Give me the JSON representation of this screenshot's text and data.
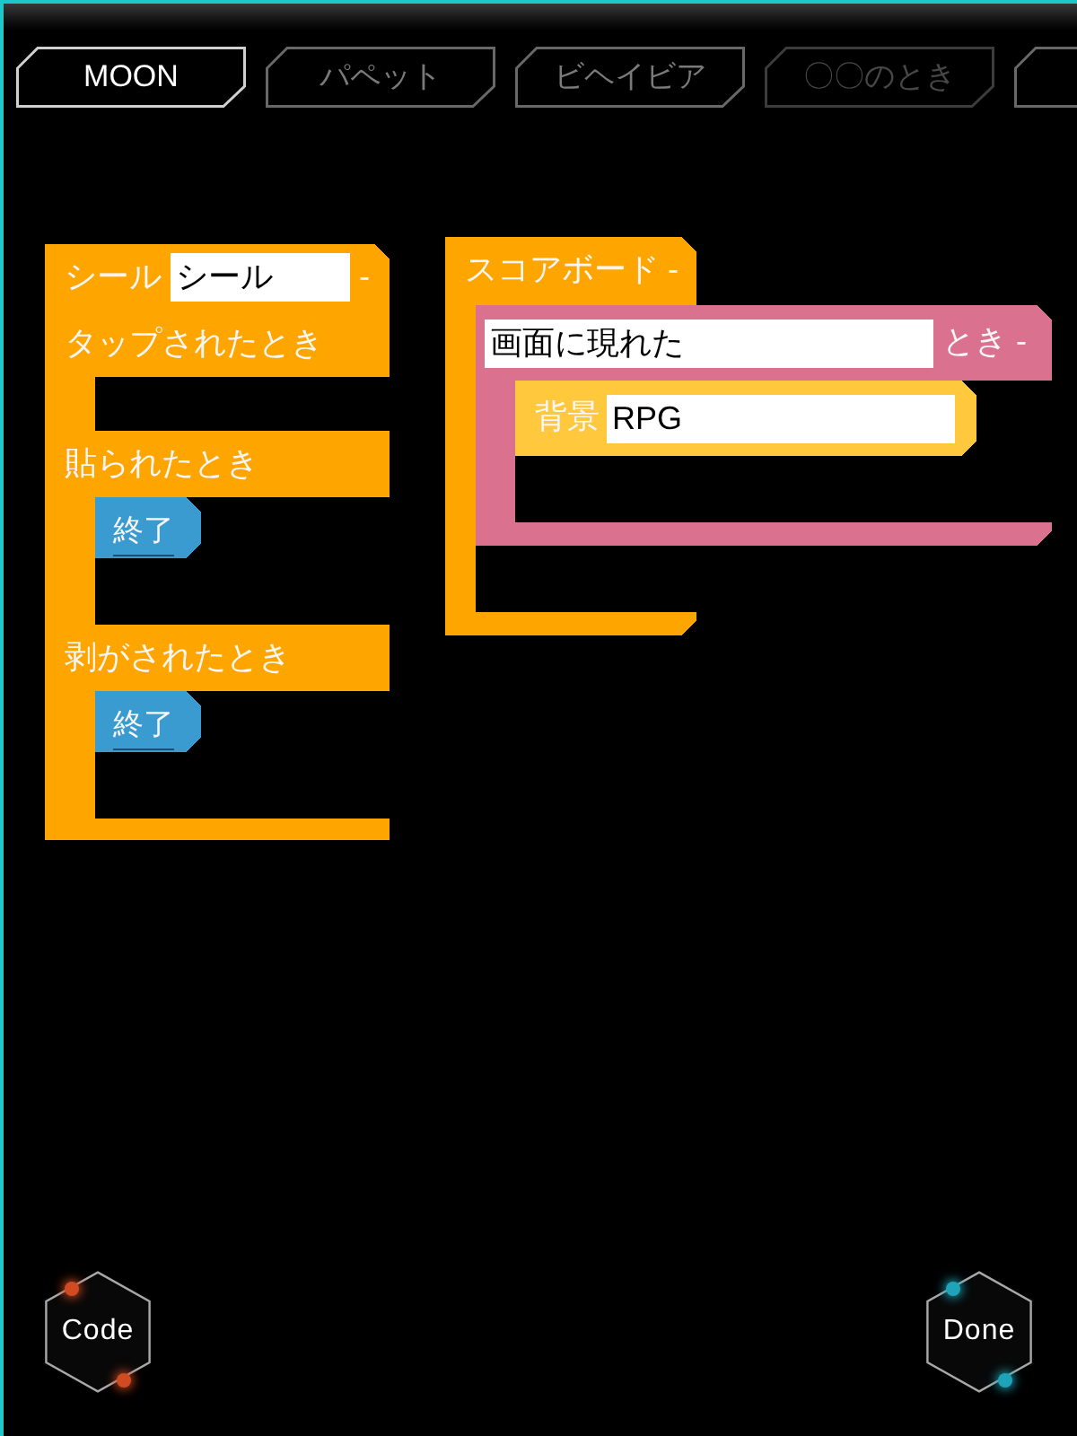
{
  "tabs": [
    {
      "label": "MOON",
      "selected": true,
      "disabled": false
    },
    {
      "label": "パペット",
      "selected": false,
      "disabled": false
    },
    {
      "label": "ビヘイビア",
      "selected": false,
      "disabled": false
    },
    {
      "label": "〇〇のとき",
      "selected": false,
      "disabled": true
    }
  ],
  "canvas": {
    "blocks": [
      {
        "kind": "event",
        "color": "#ffa500",
        "rows": [
          {
            "kind": "line",
            "parts": [
              {
                "kind": "label",
                "text": "シール"
              },
              {
                "kind": "field",
                "value": "シール"
              },
              {
                "kind": "menu",
                "text": "-"
              }
            ]
          },
          {
            "kind": "line",
            "parts": [
              {
                "kind": "label",
                "text": "タップされたとき"
              }
            ]
          },
          {
            "kind": "slot"
          },
          {
            "kind": "line",
            "parts": [
              {
                "kind": "label",
                "text": "貼られたとき"
              }
            ]
          },
          {
            "kind": "slot",
            "blocks": [
              {
                "kind": "action",
                "color": "#3a9bd0",
                "rows": [
                  {
                    "kind": "line",
                    "parts": [
                      {
                        "kind": "label",
                        "text": "終了"
                      }
                    ]
                  }
                ]
              }
            ]
          },
          {
            "kind": "line",
            "parts": [
              {
                "kind": "label",
                "text": "剥がされたとき"
              }
            ]
          },
          {
            "kind": "slot",
            "blocks": [
              {
                "kind": "action",
                "color": "#3a9bd0",
                "rows": [
                  {
                    "kind": "line",
                    "parts": [
                      {
                        "kind": "label",
                        "text": "終了"
                      }
                    ]
                  }
                ]
              }
            ]
          }
        ]
      },
      {
        "kind": "object",
        "color": "#ffa500",
        "rows": [
          {
            "kind": "line",
            "parts": [
              {
                "kind": "label",
                "text": "スコアボード"
              },
              {
                "kind": "menu",
                "text": "-"
              }
            ]
          },
          {
            "kind": "slot",
            "blocks": [
              {
                "kind": "trigger",
                "color": "#d9718f",
                "rows": [
                  {
                    "kind": "line",
                    "parts": [
                      {
                        "kind": "field",
                        "value": "画面に現れた"
                      },
                      {
                        "kind": "label",
                        "text": "とき"
                      },
                      {
                        "kind": "menu",
                        "text": "-"
                      }
                    ]
                  },
                  {
                    "kind": "slot",
                    "blocks": [
                      {
                        "kind": "setter",
                        "color": "#ffc83d",
                        "rows": [
                          {
                            "kind": "line",
                            "parts": [
                              {
                                "kind": "label",
                                "text": "背景"
                              },
                              {
                                "kind": "field",
                                "value": "RPG"
                              }
                            ]
                          }
                        ]
                      }
                    ]
                  }
                ]
              }
            ]
          }
        ]
      }
    ]
  },
  "buttons": [
    {
      "label": "Code",
      "color": "#d04a22"
    },
    {
      "label": "Done",
      "color": "#1fa3b8"
    }
  ]
}
